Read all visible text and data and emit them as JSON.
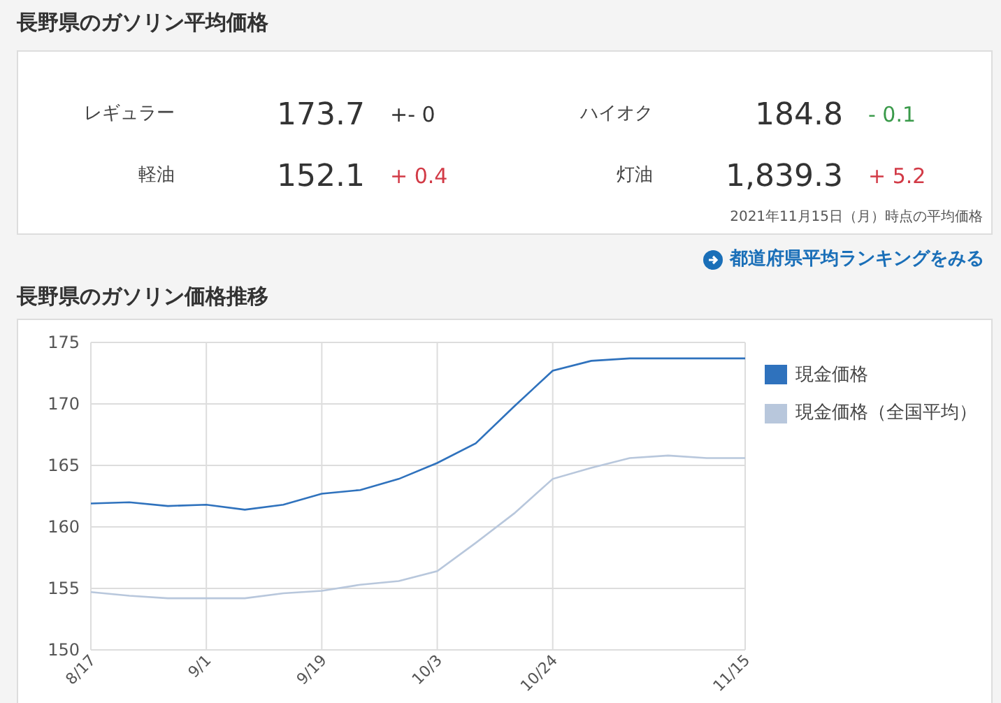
{
  "price_section": {
    "title": "長野県のガソリン平均価格",
    "prices": [
      {
        "label": "レギュラー",
        "value": "173.7",
        "change": "+- 0",
        "color": "#333333"
      },
      {
        "label": "ハイオク",
        "value": "184.8",
        "change": "- 0.1",
        "color": "#3a9a4a"
      },
      {
        "label": "軽油",
        "value": "152.1",
        "change": "+ 0.4",
        "color": "#d23a46"
      },
      {
        "label": "灯油",
        "value": "1,839.3",
        "change": "+ 5.2",
        "color": "#d23a46"
      }
    ],
    "note": "2021年11月15日（月）時点の平均価格",
    "link": "都道府県平均ランキングをみる"
  },
  "trend_section": {
    "title": "長野県のガソリン価格推移",
    "chart_data": {
      "type": "line",
      "categories": [
        "8/17",
        null,
        null,
        "9/1",
        null,
        null,
        "9/19",
        null,
        null,
        "10/3",
        null,
        null,
        "10/24",
        null,
        null,
        null,
        null,
        "11/15"
      ],
      "ylim": [
        150,
        175
      ],
      "grid": true,
      "legend": "right",
      "yticks": [
        150,
        155,
        160,
        165,
        170,
        175
      ],
      "series": [
        {
          "name": "現金価格",
          "color": "#2f72bd",
          "values": [
            161.9,
            162.0,
            161.7,
            161.8,
            161.4,
            161.8,
            162.7,
            163.0,
            163.9,
            165.2,
            166.8,
            169.8,
            172.7,
            173.5,
            173.7,
            173.7,
            173.7,
            173.7
          ]
        },
        {
          "name": "現金価格（全国平均）",
          "color": "#b8c7dc",
          "values": [
            154.7,
            154.4,
            154.2,
            154.2,
            154.2,
            154.6,
            154.8,
            155.3,
            155.6,
            156.4,
            158.7,
            161.1,
            163.9,
            164.8,
            165.6,
            165.8,
            165.6,
            165.6
          ]
        }
      ]
    }
  }
}
